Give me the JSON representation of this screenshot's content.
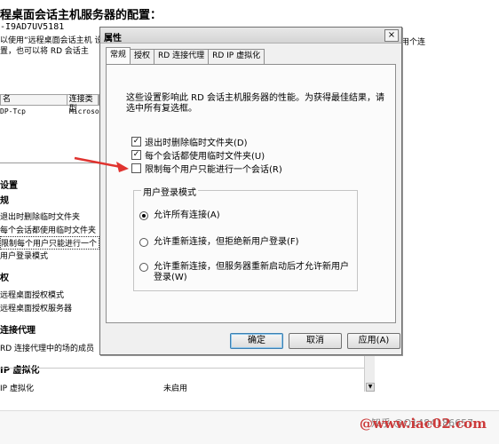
{
  "background": {
    "title": "程桌面会话主机服务器的配置：",
    "server_name": "-I9AD7UV5181",
    "desc_left": "以使用“远程桌面会话主机 设置，也可以将 RD 会话主",
    "desc_right": "用个连",
    "table_headers": [
      "名",
      "连接类型"
    ],
    "table_row": [
      "DP-Tcp",
      "Microso"
    ],
    "sections": [
      {
        "label": "设置"
      },
      {
        "label": "规"
      },
      {
        "label": "权"
      },
      {
        "label": "连接代理"
      },
      {
        "label": "IP 虚拟化"
      }
    ],
    "items": [
      "退出时删除临时文件夹",
      "每个会话都使用临时文件夹",
      "限制每个用户只能进行一个",
      "用户登录模式",
      "远程桌面授权模式",
      "远程桌面授权服务器",
      "RD 连接代理中的场的成员",
      "IP 虚拟化"
    ],
    "value_disabled": "未启用"
  },
  "dialog": {
    "title": "属性",
    "close_label": "×",
    "tabs": [
      "常规",
      "授权",
      "RD 连接代理",
      "RD IP 虚拟化"
    ],
    "active_tab": 0,
    "intro": "这些设置影响此 RD 会话主机服务器的性能。为获得最佳结果，请选中所有复选框。",
    "checkboxes": [
      {
        "label": "退出时删除临时文件夹(D)",
        "checked": true
      },
      {
        "label": "每个会话都使用临时文件夹(U)",
        "checked": true
      },
      {
        "label": "限制每个用户只能进行一个会话(R)",
        "checked": false
      }
    ],
    "group_title": "用户登录模式",
    "radios": [
      {
        "label": "允许所有连接(A)",
        "selected": true
      },
      {
        "label": "允许重新连接，但拒绝新用户登录(F)",
        "selected": false
      },
      {
        "label": "允许重新连接，但服务器重新启动后才允许新用户登录(W)",
        "selected": false
      }
    ],
    "buttons": {
      "ok": "确定",
      "cancel": "取消",
      "apply": "应用(A)"
    }
  },
  "watermark": {
    "text": "@www.iac02.com",
    "zhihu": "知乎 @Q1484186657"
  },
  "colors": {
    "arrow": "#e0332f",
    "watermark": "#cc3a3a"
  }
}
